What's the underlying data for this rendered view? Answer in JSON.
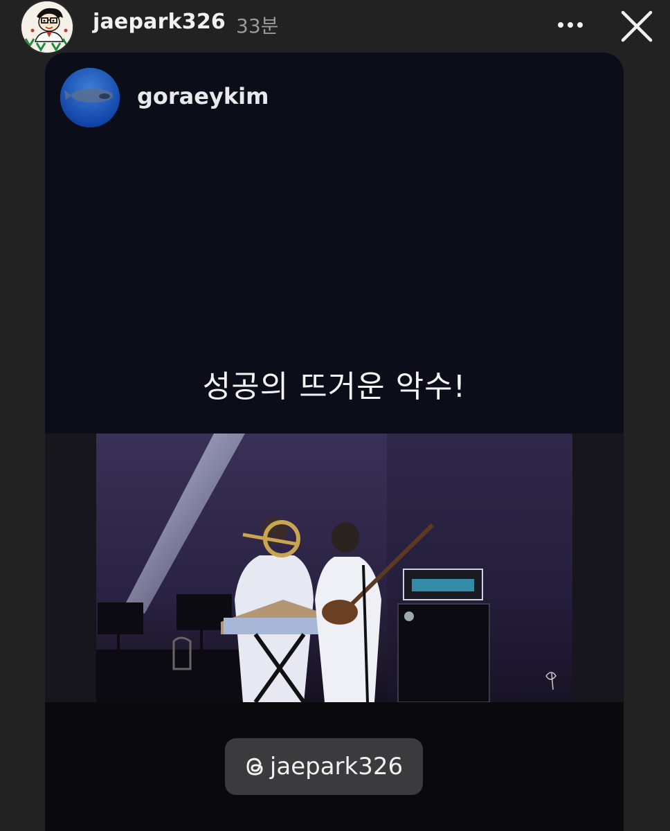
{
  "story": {
    "username": "jaepark326",
    "time_ago": "33분"
  },
  "post": {
    "author": "goraeykim",
    "caption": "성공의 뜨거운 악수!"
  },
  "mention": {
    "label": "@jaepark326",
    "icon": "threads-icon"
  },
  "icons": {
    "more": "more-horizontal-icon",
    "close": "close-icon"
  },
  "colors": {
    "background": "#222222",
    "card": "#0d0f17",
    "mention_pill": "#3b3b3d"
  }
}
